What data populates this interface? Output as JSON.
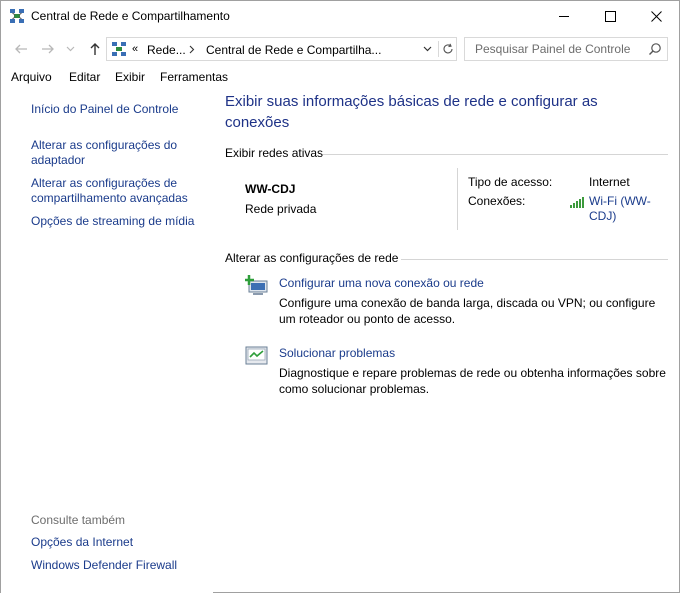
{
  "window": {
    "title": "Central de Rede e Compartilhamento"
  },
  "address": {
    "chevrons": "«",
    "segment1": "Rede...",
    "segment2": "Central de Rede e Compartilha..."
  },
  "search": {
    "placeholder": "Pesquisar Painel de Controle"
  },
  "menu": {
    "items": [
      {
        "label": "Arquivo"
      },
      {
        "label": "Editar"
      },
      {
        "label": "Exibir"
      },
      {
        "label": "Ferramentas"
      }
    ]
  },
  "sidebar": {
    "links": [
      {
        "label": "Início do Painel de Controle"
      },
      {
        "label": "Alterar as configurações do adaptador"
      },
      {
        "label": "Alterar as configurações de compartilhamento avançadas"
      },
      {
        "label": "Opções de streaming de mídia"
      }
    ],
    "see_also_label": "Consulte também",
    "see_also": [
      {
        "label": "Opções da Internet"
      },
      {
        "label": "Windows Defender Firewall"
      }
    ]
  },
  "main": {
    "title": "Exibir suas informações básicas de rede e configurar as conexões",
    "active_networks_label": "Exibir redes ativas",
    "network": {
      "name": "WW-CDJ",
      "type": "Rede privada",
      "access_type_label": "Tipo de acesso:",
      "access_type_value": "Internet",
      "connections_label": "Conexões:",
      "connection_link": "Wi-Fi (WW-CDJ)"
    },
    "change_settings_label": "Alterar as configurações de rede",
    "tasks": [
      {
        "link": "Configurar uma nova conexão ou rede",
        "description": "Configure uma conexão de banda larga, discada ou VPN; ou configure um roteador ou ponto de acesso."
      },
      {
        "link": "Solucionar problemas",
        "description": "Diagnostique e repare problemas de rede ou obtenha informações sobre como solucionar problemas."
      }
    ]
  },
  "colors": {
    "link": "#1a3b8b",
    "title": "#1e3287",
    "muted": "#6d6d6d",
    "signal": "#3c9a3c"
  }
}
